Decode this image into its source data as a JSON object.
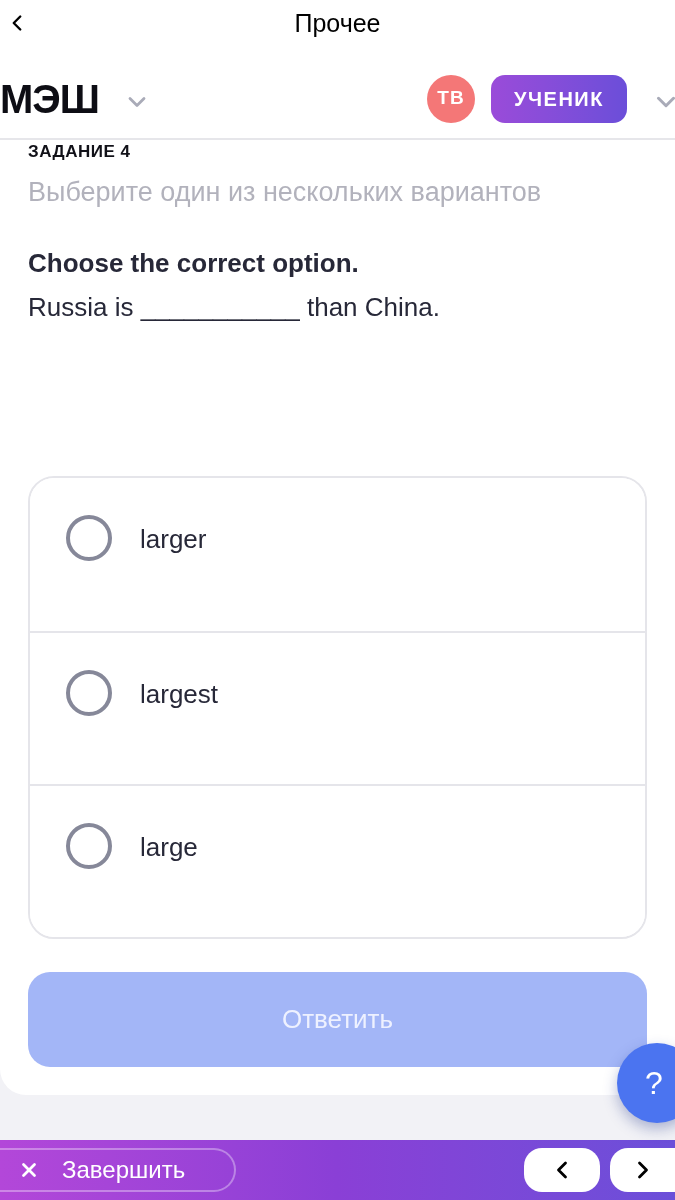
{
  "nav_bar": {
    "title": "Прочее"
  },
  "header": {
    "logo": "МЭШ",
    "avatar_initials": "ТВ",
    "role_button": "УЧЕНИК"
  },
  "task": {
    "heading": "ЗАДАНИЕ 4",
    "instruction": "Выберите один из нескольких вариантов",
    "prompt": "Choose the correct option.",
    "sentence": "Russia is ___________ than China."
  },
  "options": [
    {
      "label": "larger",
      "selected": false
    },
    {
      "label": "largest",
      "selected": false
    },
    {
      "label": "large",
      "selected": false
    }
  ],
  "submit_button": {
    "label": "Ответить",
    "disabled": true
  },
  "help_button": {
    "label": "?"
  },
  "bottom_bar": {
    "finish_button": "Завершить"
  }
}
